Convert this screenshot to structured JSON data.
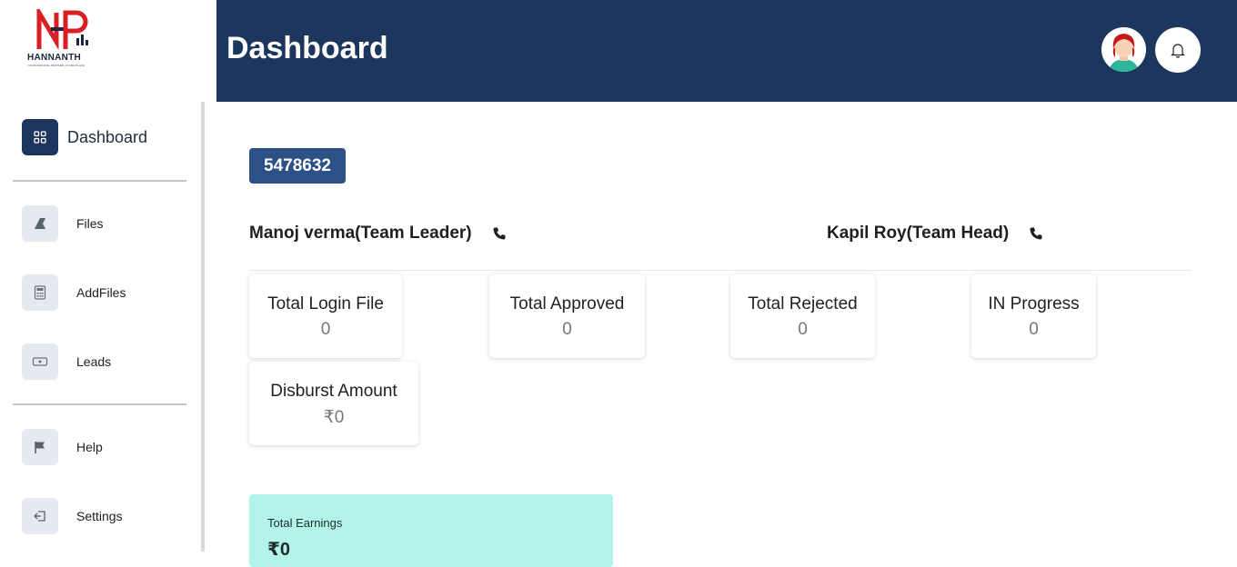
{
  "brand": {
    "name": "HANNANTH",
    "tagline": "YOUR FINANCIAL PARTNER, AT ONE PLACE"
  },
  "header": {
    "title": "Dashboard"
  },
  "sidebar": {
    "items": [
      {
        "label": "Dashboard",
        "icon": "grid-icon",
        "active": true
      },
      {
        "label": "Files",
        "icon": "files-icon"
      },
      {
        "label": "AddFiles",
        "icon": "calculator-icon"
      },
      {
        "label": "Leads",
        "icon": "ticket-icon"
      },
      {
        "label": "Help",
        "icon": "flag-icon"
      },
      {
        "label": "Settings",
        "icon": "logout-icon"
      }
    ]
  },
  "main": {
    "code": "5478632",
    "contacts": [
      {
        "label": "Manoj verma(Team Leader)"
      },
      {
        "label": "Kapil Roy(Team Head)"
      }
    ],
    "stats": [
      {
        "label": "Total Login File",
        "value": "0"
      },
      {
        "label": "Total Approved",
        "value": "0"
      },
      {
        "label": "Total Rejected",
        "value": "0"
      },
      {
        "label": "IN Progress",
        "value": "0"
      },
      {
        "label": "Disburst Amount",
        "value": "₹0"
      }
    ],
    "earnings": {
      "label": "Total Earnings",
      "value": "₹0"
    }
  },
  "colors": {
    "header": "#1c365e",
    "badge": "#2d5086",
    "earnings_bg": "#b2f4e9",
    "brand_red": "#d81f26"
  }
}
